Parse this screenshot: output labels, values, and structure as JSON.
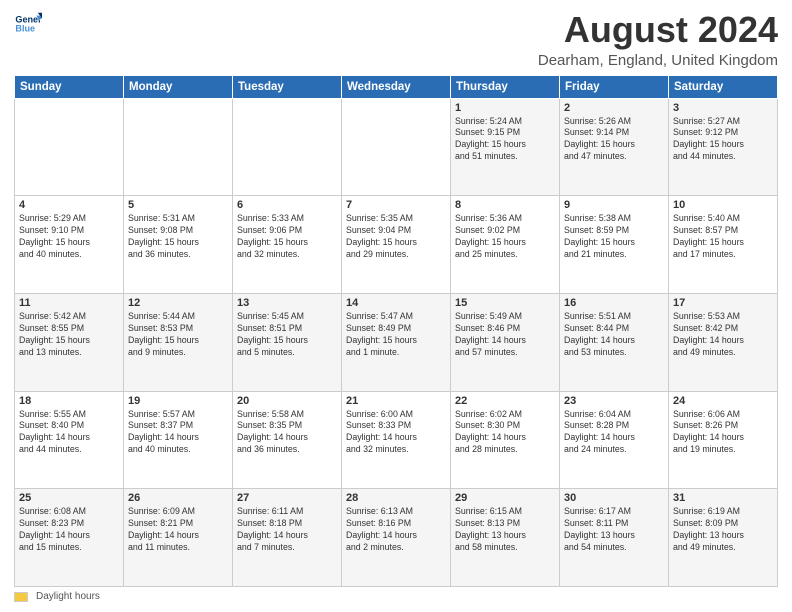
{
  "header": {
    "logo_line1": "General",
    "logo_line2": "Blue",
    "title": "August 2024",
    "subtitle": "Dearham, England, United Kingdom"
  },
  "footer": {
    "legend_label": "Daylight hours"
  },
  "weekdays": [
    "Sunday",
    "Monday",
    "Tuesday",
    "Wednesday",
    "Thursday",
    "Friday",
    "Saturday"
  ],
  "weeks": [
    [
      {
        "day": "",
        "info": ""
      },
      {
        "day": "",
        "info": ""
      },
      {
        "day": "",
        "info": ""
      },
      {
        "day": "",
        "info": ""
      },
      {
        "day": "1",
        "info": "Sunrise: 5:24 AM\nSunset: 9:15 PM\nDaylight: 15 hours\nand 51 minutes."
      },
      {
        "day": "2",
        "info": "Sunrise: 5:26 AM\nSunset: 9:14 PM\nDaylight: 15 hours\nand 47 minutes."
      },
      {
        "day": "3",
        "info": "Sunrise: 5:27 AM\nSunset: 9:12 PM\nDaylight: 15 hours\nand 44 minutes."
      }
    ],
    [
      {
        "day": "4",
        "info": "Sunrise: 5:29 AM\nSunset: 9:10 PM\nDaylight: 15 hours\nand 40 minutes."
      },
      {
        "day": "5",
        "info": "Sunrise: 5:31 AM\nSunset: 9:08 PM\nDaylight: 15 hours\nand 36 minutes."
      },
      {
        "day": "6",
        "info": "Sunrise: 5:33 AM\nSunset: 9:06 PM\nDaylight: 15 hours\nand 32 minutes."
      },
      {
        "day": "7",
        "info": "Sunrise: 5:35 AM\nSunset: 9:04 PM\nDaylight: 15 hours\nand 29 minutes."
      },
      {
        "day": "8",
        "info": "Sunrise: 5:36 AM\nSunset: 9:02 PM\nDaylight: 15 hours\nand 25 minutes."
      },
      {
        "day": "9",
        "info": "Sunrise: 5:38 AM\nSunset: 8:59 PM\nDaylight: 15 hours\nand 21 minutes."
      },
      {
        "day": "10",
        "info": "Sunrise: 5:40 AM\nSunset: 8:57 PM\nDaylight: 15 hours\nand 17 minutes."
      }
    ],
    [
      {
        "day": "11",
        "info": "Sunrise: 5:42 AM\nSunset: 8:55 PM\nDaylight: 15 hours\nand 13 minutes."
      },
      {
        "day": "12",
        "info": "Sunrise: 5:44 AM\nSunset: 8:53 PM\nDaylight: 15 hours\nand 9 minutes."
      },
      {
        "day": "13",
        "info": "Sunrise: 5:45 AM\nSunset: 8:51 PM\nDaylight: 15 hours\nand 5 minutes."
      },
      {
        "day": "14",
        "info": "Sunrise: 5:47 AM\nSunset: 8:49 PM\nDaylight: 15 hours\nand 1 minute."
      },
      {
        "day": "15",
        "info": "Sunrise: 5:49 AM\nSunset: 8:46 PM\nDaylight: 14 hours\nand 57 minutes."
      },
      {
        "day": "16",
        "info": "Sunrise: 5:51 AM\nSunset: 8:44 PM\nDaylight: 14 hours\nand 53 minutes."
      },
      {
        "day": "17",
        "info": "Sunrise: 5:53 AM\nSunset: 8:42 PM\nDaylight: 14 hours\nand 49 minutes."
      }
    ],
    [
      {
        "day": "18",
        "info": "Sunrise: 5:55 AM\nSunset: 8:40 PM\nDaylight: 14 hours\nand 44 minutes."
      },
      {
        "day": "19",
        "info": "Sunrise: 5:57 AM\nSunset: 8:37 PM\nDaylight: 14 hours\nand 40 minutes."
      },
      {
        "day": "20",
        "info": "Sunrise: 5:58 AM\nSunset: 8:35 PM\nDaylight: 14 hours\nand 36 minutes."
      },
      {
        "day": "21",
        "info": "Sunrise: 6:00 AM\nSunset: 8:33 PM\nDaylight: 14 hours\nand 32 minutes."
      },
      {
        "day": "22",
        "info": "Sunrise: 6:02 AM\nSunset: 8:30 PM\nDaylight: 14 hours\nand 28 minutes."
      },
      {
        "day": "23",
        "info": "Sunrise: 6:04 AM\nSunset: 8:28 PM\nDaylight: 14 hours\nand 24 minutes."
      },
      {
        "day": "24",
        "info": "Sunrise: 6:06 AM\nSunset: 8:26 PM\nDaylight: 14 hours\nand 19 minutes."
      }
    ],
    [
      {
        "day": "25",
        "info": "Sunrise: 6:08 AM\nSunset: 8:23 PM\nDaylight: 14 hours\nand 15 minutes."
      },
      {
        "day": "26",
        "info": "Sunrise: 6:09 AM\nSunset: 8:21 PM\nDaylight: 14 hours\nand 11 minutes."
      },
      {
        "day": "27",
        "info": "Sunrise: 6:11 AM\nSunset: 8:18 PM\nDaylight: 14 hours\nand 7 minutes."
      },
      {
        "day": "28",
        "info": "Sunrise: 6:13 AM\nSunset: 8:16 PM\nDaylight: 14 hours\nand 2 minutes."
      },
      {
        "day": "29",
        "info": "Sunrise: 6:15 AM\nSunset: 8:13 PM\nDaylight: 13 hours\nand 58 minutes."
      },
      {
        "day": "30",
        "info": "Sunrise: 6:17 AM\nSunset: 8:11 PM\nDaylight: 13 hours\nand 54 minutes."
      },
      {
        "day": "31",
        "info": "Sunrise: 6:19 AM\nSunset: 8:09 PM\nDaylight: 13 hours\nand 49 minutes."
      }
    ]
  ]
}
